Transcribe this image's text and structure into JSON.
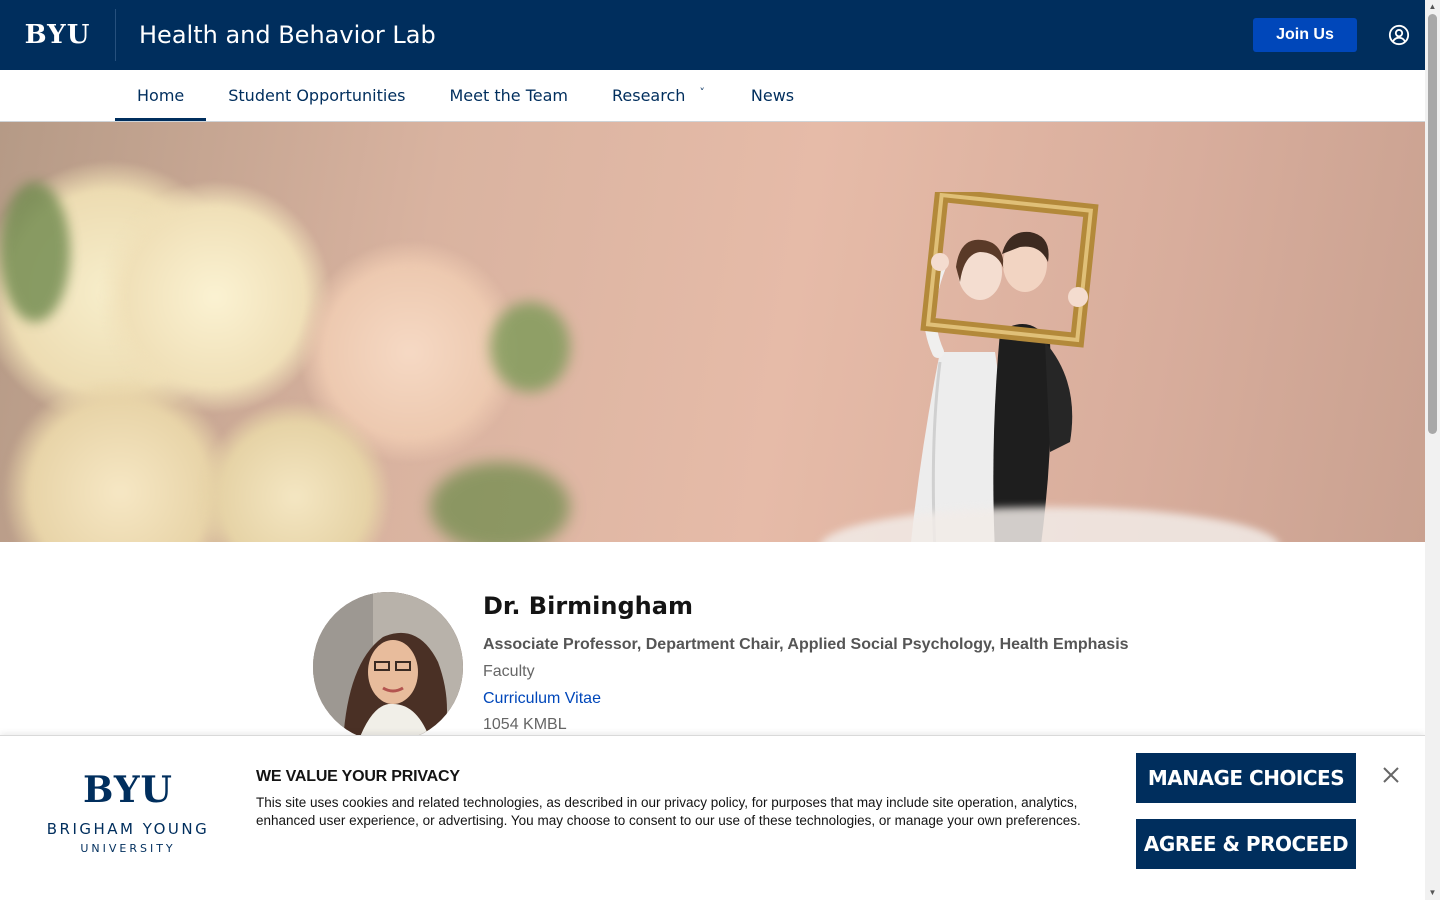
{
  "header": {
    "logo_text": "BYU",
    "site_title": "Health and Behavior Lab",
    "join_label": "Join Us",
    "user_icon": "user-circle-icon",
    "background_color": "#002e5d",
    "button_color": "#0047ba"
  },
  "nav": {
    "items": [
      {
        "label": "Home",
        "active": true
      },
      {
        "label": "Student Opportunities",
        "active": false
      },
      {
        "label": "Meet the Team",
        "active": false
      },
      {
        "label": "Research",
        "active": false,
        "has_dropdown": true
      },
      {
        "label": "News",
        "active": false
      }
    ],
    "caret_glyph": "˅"
  },
  "profile": {
    "name": "Dr. Birmingham",
    "title": "Associate Professor, Department Chair, Applied Social Psychology, Health Emphasis",
    "role": "Faculty",
    "cv_link": "Curriculum Vitae",
    "office": "1054 KMBL"
  },
  "cookie_banner": {
    "logo_mark": "BYU",
    "logo_line1": "BRIGHAM YOUNG",
    "logo_line2": "UNIVERSITY",
    "heading": "WE VALUE YOUR PRIVACY",
    "text": "This site uses cookies and related technologies, as described in our privacy policy, for purposes that may include site operation, analytics, enhanced user experience, or advertising. You may choose to consent to our use of these technologies, or manage your own preferences.",
    "manage_label": "MANAGE CHOICES",
    "agree_label": "AGREE & PROCEED",
    "close_icon": "close-icon"
  },
  "scrollbar": {
    "up_glyph": "▲",
    "down_glyph": "▼"
  }
}
